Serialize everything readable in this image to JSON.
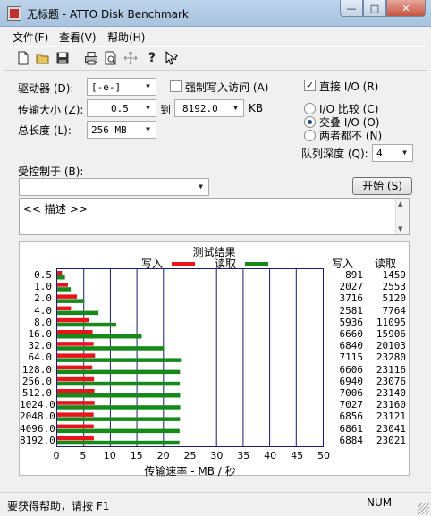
{
  "window": {
    "title": "无标题 - ATTO Disk Benchmark",
    "min": "—",
    "max": "□",
    "close": "✕"
  },
  "menu": [
    "文件(F)",
    "查看(V)",
    "帮助(H)"
  ],
  "toolbar_icons": [
    "new-icon",
    "open-icon",
    "save-icon",
    "print-icon",
    "print-preview-icon",
    "move-icon",
    "help-icon",
    "context-help-icon"
  ],
  "form": {
    "drive_label": "驱动器 (D):",
    "drive_value": "[-e-]",
    "force_write_label": "强制写入访问 (A)",
    "transfer_label": "传输大小 (Z):",
    "transfer_from": "0.5",
    "to_label": "到",
    "transfer_to": "8192.0",
    "kb_label": "KB",
    "total_label": "总长度 (L):",
    "total_value": "256 MB",
    "direct_io_label": "直接 I/O (R)",
    "direct_io_checked": true,
    "io_compare_label": "I/O 比较 (C)",
    "overlapped_label": "交叠 I/O (O)",
    "neither_label": "两者都不 (N)",
    "queue_label": "队列深度 (Q):",
    "queue_value": "4",
    "controlled_by_label": "受控制于 (B):",
    "controlled_by_value": "",
    "start_button": "开始 (S)",
    "description": "<< 描述 >>"
  },
  "results": {
    "title": "测试结果",
    "write_legend": "写入",
    "read_legend": "读取",
    "write_header": "写入",
    "read_header": "读取",
    "x_label": "传输速率 - MB / 秒",
    "colors": {
      "write": "#e8141a",
      "read": "#16891a",
      "grid": "#1b1b6e"
    }
  },
  "chart_data": {
    "type": "bar",
    "orientation": "horizontal",
    "categories": [
      "0.5",
      "1.0",
      "2.0",
      "4.0",
      "8.0",
      "16.0",
      "32.0",
      "64.0",
      "128.0",
      "256.0",
      "512.0",
      "1024.0",
      "2048.0",
      "4096.0",
      "8192.0"
    ],
    "series": [
      {
        "name": "写入",
        "values": [
          891,
          2027,
          3716,
          2581,
          5936,
          6660,
          6840,
          7115,
          6606,
          6940,
          7006,
          7027,
          6856,
          6861,
          6884
        ]
      },
      {
        "name": "读取",
        "values": [
          1459,
          2553,
          5120,
          7764,
          11095,
          15906,
          20103,
          23280,
          23116,
          23076,
          23140,
          23160,
          23121,
          23041,
          23021
        ]
      }
    ],
    "xlabel": "传输速率 - MB / 秒",
    "x_ticks": [
      "0",
      "5",
      "10",
      "15",
      "20",
      "25",
      "30",
      "35",
      "40",
      "45",
      "50"
    ],
    "xlim": [
      0,
      50
    ],
    "grid": "vertical"
  },
  "statusbar": {
    "help": "要获得帮助，请按 F1",
    "num": "NUM"
  }
}
